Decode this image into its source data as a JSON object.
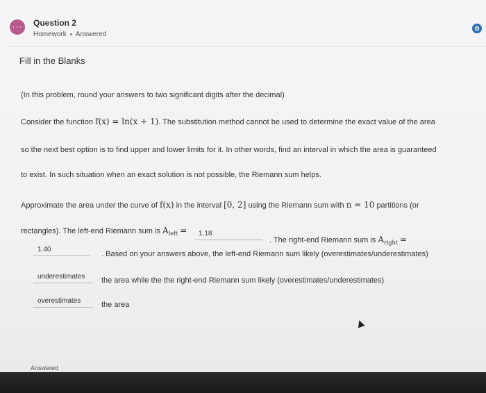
{
  "header": {
    "badge_icon": "ellipsis-icon",
    "badge_glyph": "···",
    "question_title": "Question 2",
    "type": "Homework",
    "status": "Answered",
    "right_icon": "settings-icon",
    "right_glyph": "✿"
  },
  "section": {
    "title": "Fill in the Blanks"
  },
  "content": {
    "instruction": "(In this problem, round your answers to two significant digits after the decimal)",
    "line1_a": "Consider the function",
    "line1_func": "f(x) = ln(x + 1)",
    "line1_b": ". The substitution method cannot be used to determine the exact value of the area",
    "line2": "so the next best option is to find upper and lower limits for it. In other words, find an interval in which the area is guaranteed",
    "line3": "to exist. In such situation when an exact solution is not possible, the Riemann sum helps.",
    "line4_a": "Approximate the area under the curve of",
    "line4_fx": "f(x)",
    "line4_b": "in the interval",
    "line4_interval": "[0, 2]",
    "line4_c": "using the Riemann sum with",
    "line4_n": "n = 10",
    "line4_d": "partitions (or",
    "line5_a": "rectangles). The left-end Riemann sum is",
    "a_left_main": "A",
    "a_left_sub": "left",
    "equals": "=",
    "line5_b": ". The right-end Riemann sum is",
    "a_right_main": "A",
    "a_right_sub": "right",
    "line6_b": ". Based on your answers above, the left-end Riemann sum likely (overestimates/underestimates)",
    "line7": "the area while the the right-end Riemann sum likely (overestimates/underestimates)",
    "line8": "the area"
  },
  "answers": {
    "left_sum": "1.18",
    "right_sum": "1.40",
    "left_estimate": "underestimates",
    "right_estimate": "overestimates"
  },
  "footer": {
    "status": "Answered"
  }
}
